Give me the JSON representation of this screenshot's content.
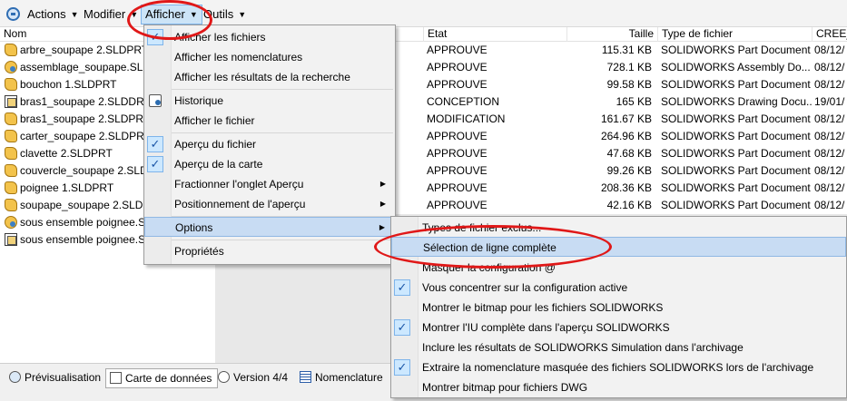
{
  "menubar": {
    "actions": "Actions",
    "modifier": "Modifier",
    "afficher": "Afficher",
    "outils": "Outils"
  },
  "columns": {
    "nom": "Nom",
    "etat": "Etat",
    "taille": "Taille",
    "type": "Type de fichier",
    "cree": "CREE_L"
  },
  "files": [
    {
      "name": "arbre_soupape 2.SLDPRT",
      "icon": "part-icon"
    },
    {
      "name": "assemblage_soupape.SLD",
      "icon": "assembly-icon"
    },
    {
      "name": "bouchon 1.SLDPRT",
      "icon": "part-icon"
    },
    {
      "name": "bras1_soupape 2.SLDDRW",
      "icon": "drawing-icon"
    },
    {
      "name": "bras1_soupape 2.SLDPRT",
      "icon": "part-icon"
    },
    {
      "name": "carter_soupape 2.SLDPR",
      "icon": "part-icon"
    },
    {
      "name": "clavette 2.SLDPRT",
      "icon": "part-icon"
    },
    {
      "name": "couvercle_soupape 2.SLD",
      "icon": "part-icon"
    },
    {
      "name": "poignee 1.SLDPRT",
      "icon": "part-icon"
    },
    {
      "name": "soupape_soupape 2.SLDP",
      "icon": "part-icon"
    },
    {
      "name": "sous ensemble poignee.S",
      "icon": "assembly-icon"
    },
    {
      "name": "sous ensemble poignee.S",
      "icon": "drawing-icon"
    }
  ],
  "rows": [
    {
      "etat": "APPROUVE",
      "taille": "115.31 KB",
      "type": "SOLIDWORKS Part Document",
      "cree": "08/12/"
    },
    {
      "etat": "APPROUVE",
      "taille": "728.1 KB",
      "type": "SOLIDWORKS Assembly Do...",
      "cree": "08/12/"
    },
    {
      "etat": "APPROUVE",
      "taille": "99.58 KB",
      "type": "SOLIDWORKS Part Document",
      "cree": "08/12/"
    },
    {
      "etat": "CONCEPTION",
      "taille": "165 KB",
      "type": "SOLIDWORKS Drawing Docu...",
      "cree": "19/01/"
    },
    {
      "etat": "MODIFICATION",
      "taille": "161.67 KB",
      "type": "SOLIDWORKS Part Document",
      "cree": "08/12/"
    },
    {
      "etat": "APPROUVE",
      "taille": "264.96 KB",
      "type": "SOLIDWORKS Part Document",
      "cree": "08/12/"
    },
    {
      "etat": "APPROUVE",
      "taille": "47.68 KB",
      "type": "SOLIDWORKS Part Document",
      "cree": "08/12/"
    },
    {
      "etat": "APPROUVE",
      "taille": "99.26 KB",
      "type": "SOLIDWORKS Part Document",
      "cree": "08/12/"
    },
    {
      "etat": "APPROUVE",
      "taille": "208.36 KB",
      "type": "SOLIDWORKS Part Document",
      "cree": "08/12/"
    },
    {
      "etat": "APPROUVE",
      "taille": "42.16 KB",
      "type": "SOLIDWORKS Part Document",
      "cree": "08/12/"
    }
  ],
  "afficher_menu": {
    "fichiers": "Afficher les fichiers",
    "nomenclatures": "Afficher les nomenclatures",
    "resultats": "Afficher les résultats de la recherche",
    "historique": "Historique",
    "fichier": "Afficher le fichier",
    "apercu_fichier": "Aperçu du fichier",
    "apercu_carte": "Aperçu de la carte",
    "fractionner": "Fractionner l'onglet Aperçu",
    "positionnement": "Positionnement de l'aperçu",
    "options": "Options",
    "proprietes": "Propriétés"
  },
  "options_menu": {
    "types_exclus": "Types de fichier exclus...",
    "selection_ligne": "Sélection de ligne complète",
    "masquer_config": "Masquer la configuration @",
    "concentrer": "Vous concentrer sur la configuration active",
    "bitmap_sw": "Montrer le bitmap pour les fichiers SOLIDWORKS",
    "iu_complete": "Montrer l'IU complète dans l'aperçu SOLIDWORKS",
    "simulation": "Inclure les résultats de SOLIDWORKS Simulation dans l'archivage",
    "nomenclature_masquee": "Extraire la nomenclature masquée des fichiers SOLIDWORKS lors de l'archivage",
    "bitmap_dwg": "Montrer bitmap pour fichiers DWG"
  },
  "tabs": {
    "previsualisation": "Prévisualisation",
    "carte": "Carte de données",
    "version": "Version 4/4",
    "nomenclature": "Nomenclature"
  },
  "colors": {
    "annotation": "#e01818",
    "hover": "#c8dcf3",
    "check": "#1a56a8"
  }
}
